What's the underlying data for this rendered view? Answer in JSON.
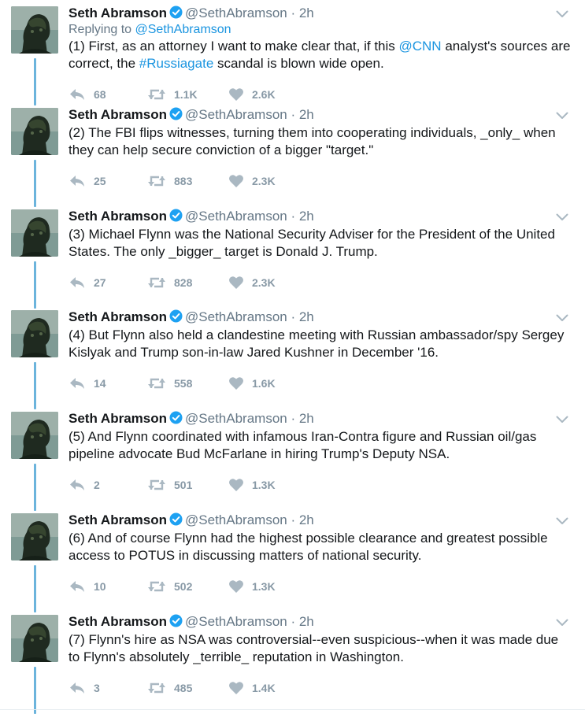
{
  "colors": {
    "link": "#1b95e0",
    "verified": "#1da1f2",
    "thread_line": "#6cb4dc",
    "muted": "#657786",
    "action": "#8899a6"
  },
  "icons": {
    "reply": "reply-arrow-icon",
    "retweet": "retweet-icon",
    "like": "heart-icon",
    "menu": "chevron-down-icon",
    "verified": "verified-badge-icon"
  },
  "tweets": [
    {
      "name": "Seth Abramson",
      "handle": "@SethAbramson",
      "time": "2h",
      "reply_to_prefix": "Replying to",
      "reply_to": "@SethAbramson",
      "text_parts": [
        {
          "t": "(1) First, as an attorney I want to make clear that, if this "
        },
        {
          "t": "@CNN",
          "link": true
        },
        {
          "t": " analyst's sources are correct, the "
        },
        {
          "t": "#Russiagate",
          "link": true
        },
        {
          "t": " scandal is blown wide open."
        }
      ],
      "replies": "68",
      "retweets": "1.1K",
      "likes": "2.6K"
    },
    {
      "name": "Seth Abramson",
      "handle": "@SethAbramson",
      "time": "2h",
      "text_parts": [
        {
          "t": "(2) The FBI flips witnesses, turning them into cooperating individuals, _only_ when they can help secure conviction of a bigger \"target.\""
        }
      ],
      "replies": "25",
      "retweets": "883",
      "likes": "2.3K"
    },
    {
      "name": "Seth Abramson",
      "handle": "@SethAbramson",
      "time": "2h",
      "text_parts": [
        {
          "t": "(3) Michael Flynn was the National Security Adviser for the President of the United States. The only _bigger_ target is Donald J. Trump."
        }
      ],
      "replies": "27",
      "retweets": "828",
      "likes": "2.3K"
    },
    {
      "name": "Seth Abramson",
      "handle": "@SethAbramson",
      "time": "2h",
      "text_parts": [
        {
          "t": "(4) But Flynn also held a clandestine meeting with Russian ambassador/spy Sergey Kislyak and Trump son-in-law Jared Kushner in December '16."
        }
      ],
      "replies": "14",
      "retweets": "558",
      "likes": "1.6K"
    },
    {
      "name": "Seth Abramson",
      "handle": "@SethAbramson",
      "time": "2h",
      "text_parts": [
        {
          "t": "(5) And Flynn coordinated with infamous Iran-Contra figure and Russian oil/gas pipeline advocate Bud McFarlane in hiring Trump's Deputy NSA."
        }
      ],
      "replies": "2",
      "retweets": "501",
      "likes": "1.3K"
    },
    {
      "name": "Seth Abramson",
      "handle": "@SethAbramson",
      "time": "2h",
      "text_parts": [
        {
          "t": "(6) And of course Flynn had the highest possible clearance and greatest possible access to POTUS in discussing matters of national security."
        }
      ],
      "replies": "10",
      "retweets": "502",
      "likes": "1.3K"
    },
    {
      "name": "Seth Abramson",
      "handle": "@SethAbramson",
      "time": "2h",
      "text_parts": [
        {
          "t": "(7) Flynn's hire as NSA was controversial--even suspicious--when it was made due to Flynn's absolutely _terrible_ reputation in Washington."
        }
      ],
      "replies": "3",
      "retweets": "485",
      "likes": "1.4K"
    }
  ]
}
